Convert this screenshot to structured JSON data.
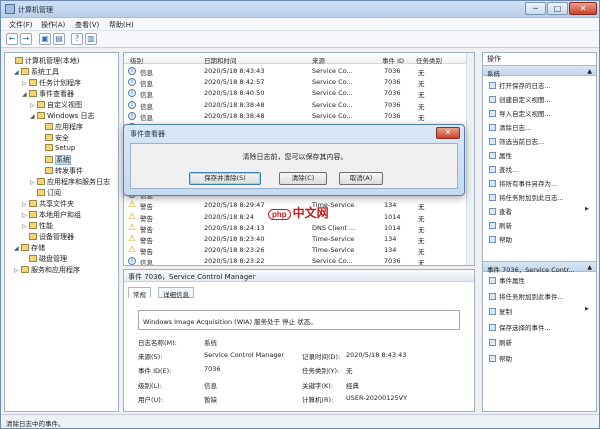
{
  "window": {
    "title": "计算机管理",
    "min": "─",
    "max": "□",
    "close": "✕"
  },
  "menu": [
    "文件(F)",
    "操作(A)",
    "查看(V)",
    "帮助(H)"
  ],
  "toolbar": [
    "←",
    "→",
    "▣",
    "▤",
    "?",
    "▥"
  ],
  "tree": [
    {
      "label": "计算机管理(本地)",
      "level": 0,
      "exp": ""
    },
    {
      "label": "系统工具",
      "level": 1,
      "exp": "◢"
    },
    {
      "label": "任务计划程序",
      "level": 2,
      "exp": "▷"
    },
    {
      "label": "事件查看器",
      "level": 2,
      "exp": "◢"
    },
    {
      "label": "自定义视图",
      "level": 3,
      "exp": "▷"
    },
    {
      "label": "Windows 日志",
      "level": 3,
      "exp": "◢"
    },
    {
      "label": "应用程序",
      "level": 4,
      "exp": ""
    },
    {
      "label": "安全",
      "level": 4,
      "exp": ""
    },
    {
      "label": "Setup",
      "level": 4,
      "exp": ""
    },
    {
      "label": "系统",
      "level": 4,
      "exp": ""
    },
    {
      "label": "转发事件",
      "level": 4,
      "exp": ""
    },
    {
      "label": "应用程序和服务日志",
      "level": 3,
      "exp": "▷"
    },
    {
      "label": "订阅",
      "level": 3,
      "exp": ""
    },
    {
      "label": "共享文件夹",
      "level": 2,
      "exp": "▷"
    },
    {
      "label": "本地用户和组",
      "level": 2,
      "exp": "▷"
    },
    {
      "label": "性能",
      "level": 2,
      "exp": "▷"
    },
    {
      "label": "设备管理器",
      "level": 2,
      "exp": ""
    },
    {
      "label": "存储",
      "level": 1,
      "exp": "◢"
    },
    {
      "label": "磁盘管理",
      "level": 2,
      "exp": ""
    },
    {
      "label": "服务和应用程序",
      "level": 1,
      "exp": "▷"
    }
  ],
  "list": {
    "headers": [
      "级别",
      "日期和时间",
      "来源",
      "事件 ID",
      "任务类别"
    ],
    "rows": [
      {
        "level": "信息",
        "date": "2020/5/18 8:43:43",
        "source": "Service Co...",
        "id": "7036",
        "task": "无",
        "warn": false
      },
      {
        "level": "信息",
        "date": "2020/5/18 8:42:57",
        "source": "Service Co...",
        "id": "7036",
        "task": "无",
        "warn": false
      },
      {
        "level": "信息",
        "date": "2020/5/18 8:40:50",
        "source": "Service Co...",
        "id": "7036",
        "task": "无",
        "warn": false
      },
      {
        "level": "信息",
        "date": "2020/5/18 8:38:48",
        "source": "Service Co...",
        "id": "7036",
        "task": "无",
        "warn": false
      },
      {
        "level": "信息",
        "date": "2020/5/18 8:38:48",
        "source": "Service Co...",
        "id": "7036",
        "task": "无",
        "warn": false
      },
      {
        "level": "信息",
        "date": "",
        "source": "",
        "id": "",
        "task": "",
        "warn": false
      },
      {
        "level": "信息",
        "date": "",
        "source": "",
        "id": "",
        "task": "",
        "warn": false
      },
      {
        "level": "信息",
        "date": "",
        "source": "",
        "id": "",
        "task": "",
        "warn": false
      },
      {
        "level": "信息",
        "date": "",
        "source": "",
        "id": "",
        "task": "",
        "warn": false
      },
      {
        "level": "信息",
        "date": "",
        "source": "",
        "id": "",
        "task": "",
        "warn": false
      },
      {
        "level": "信息",
        "date": "",
        "source": "",
        "id": "",
        "task": "",
        "warn": false
      },
      {
        "level": "信息",
        "date": "",
        "source": "",
        "id": "",
        "task": "",
        "warn": false
      },
      {
        "level": "警告",
        "date": "2020/5/18 8:29:47",
        "source": "Time-Service",
        "id": "134",
        "task": "无",
        "warn": true
      },
      {
        "level": "警告",
        "date": "2020/5/18 8:24",
        "source": "",
        "id": "1014",
        "task": "无",
        "warn": true
      },
      {
        "level": "警告",
        "date": "2020/5/18 8:24:13",
        "source": "DNS Client ...",
        "id": "1014",
        "task": "无",
        "warn": true
      },
      {
        "level": "警告",
        "date": "2020/5/18 8:23:40",
        "source": "Time-Service",
        "id": "134",
        "task": "无",
        "warn": true
      },
      {
        "level": "警告",
        "date": "2020/5/18 8:23:26",
        "source": "Time-Service",
        "id": "134",
        "task": "无",
        "warn": true
      },
      {
        "level": "信息",
        "date": "2020/5/18 8:23:22",
        "source": "Service Co...",
        "id": "7036",
        "task": "无",
        "warn": false
      }
    ]
  },
  "detail": {
    "title": "事件 7036，Service Control Manager",
    "tabs": [
      "常规",
      "详细信息"
    ],
    "message": "Windows Image Acquisition (WIA) 服务处于 停止 状态。",
    "fields": [
      {
        "k": "日志名称(M):",
        "v": "系统"
      },
      {
        "k": "来源(S):",
        "v": "Service Control Manager"
      },
      {
        "k": "记录时间(D):",
        "v": "2020/5/18 8:43:43"
      },
      {
        "k": "事件 ID(E):",
        "v": "7036"
      },
      {
        "k": "任务类别(Y):",
        "v": "无"
      },
      {
        "k": "级别(L):",
        "v": "信息"
      },
      {
        "k": "关键字(K):",
        "v": "经典"
      },
      {
        "k": "用户(U):",
        "v": "暂缺"
      },
      {
        "k": "计算机(R):",
        "v": "USER-20200125VY"
      }
    ]
  },
  "actions": {
    "header": "操作",
    "sec1": "系统",
    "items1": [
      "打开保存的日志...",
      "创建自定义视图...",
      "导入自定义视图...",
      "清除日志...",
      "筛选当前日志...",
      "属性",
      "查找...",
      "将所有事件另存为...",
      "将任务附加到此日志...",
      "查看",
      "刷新",
      "帮助"
    ],
    "sec2": "事件 7036，Service Contr...",
    "items2": [
      "事件属性",
      "将任务附加到此事件...",
      "复制",
      "保存选择的事件...",
      "刷新",
      "帮助"
    ]
  },
  "status": "清除日志中的事件。",
  "dialog": {
    "title": "事件查看器",
    "close": "✕",
    "message": "清除日志前，您可以保存其内容。",
    "buttons": [
      "保存并清除(S)",
      "清除(C)",
      "取消(A)"
    ]
  },
  "watermark": {
    "logo": "php",
    "text": "中文网"
  }
}
